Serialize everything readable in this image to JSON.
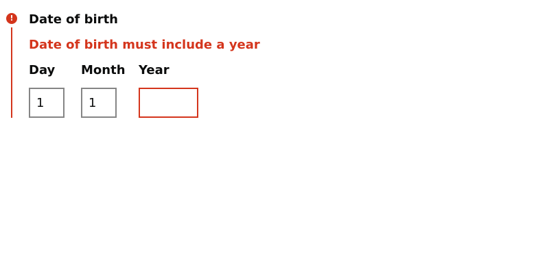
{
  "form": {
    "legend": "Date of birth",
    "error_message": "Date of birth must include a year",
    "error_icon": "!",
    "colors": {
      "error": "#d4351c",
      "text": "#0b0c0c",
      "input_border": "#858585"
    },
    "fields": [
      {
        "label": "Day",
        "value": "1"
      },
      {
        "label": "Month",
        "value": "1"
      },
      {
        "label": "Year",
        "value": ""
      }
    ]
  }
}
